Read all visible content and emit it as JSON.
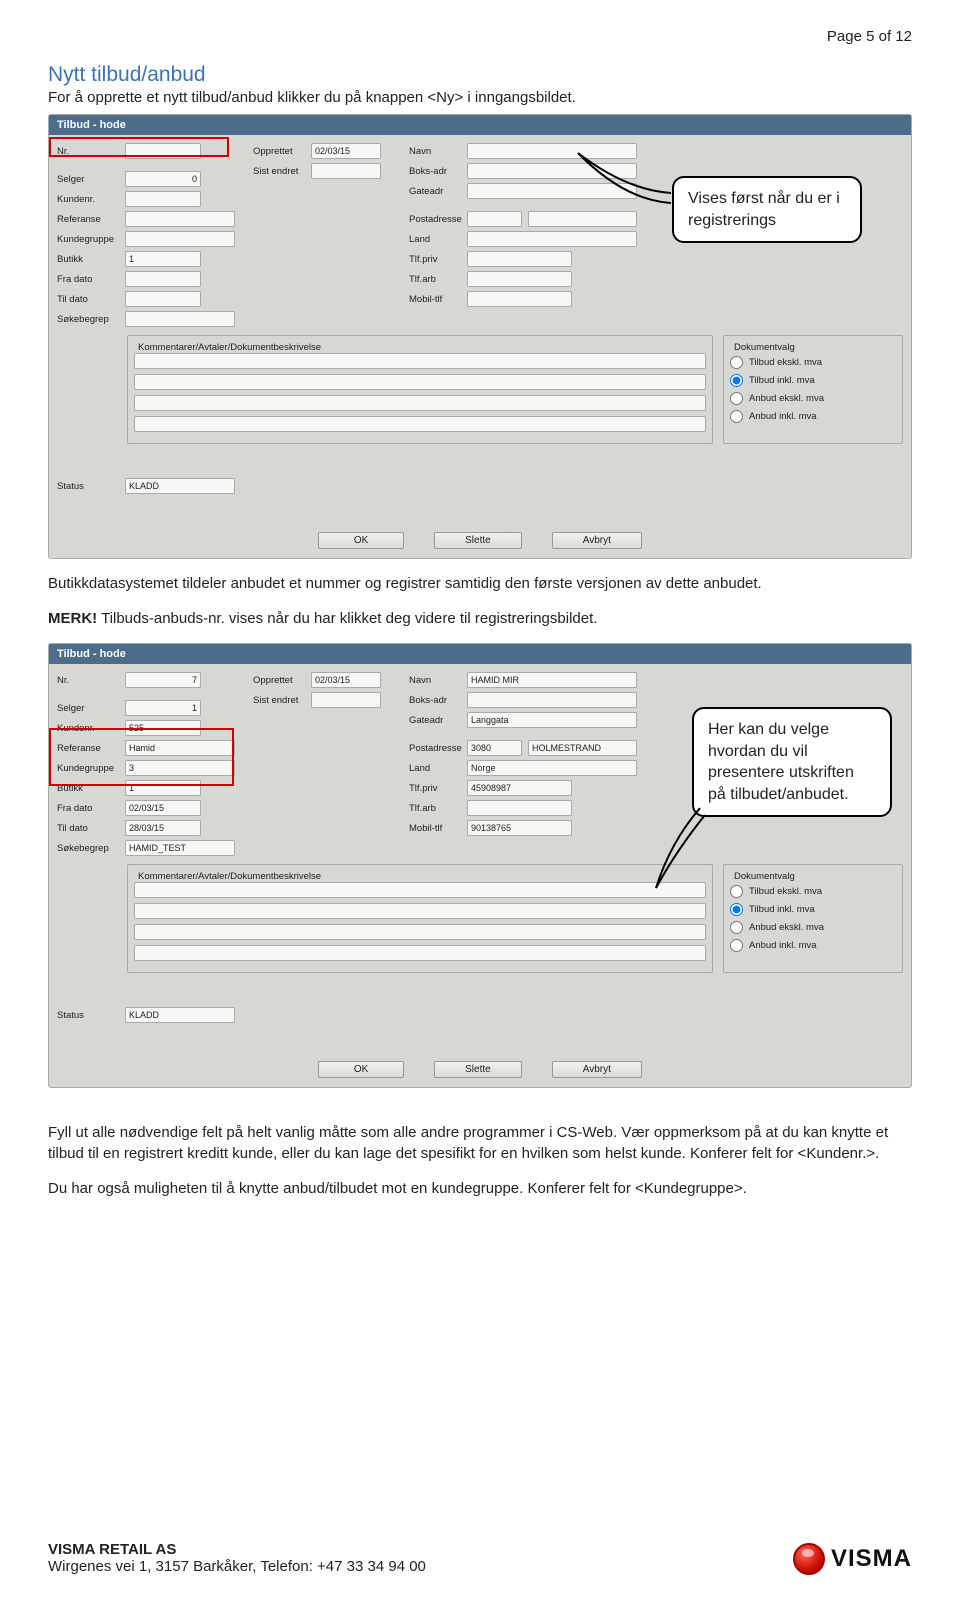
{
  "page_num": "Page 5 of 12",
  "doc": {
    "title": "Nytt tilbud/anbud",
    "intro": "For å opprette et nytt tilbud/anbud klikker du på knappen <Ny> i inngangsbildet."
  },
  "panel1": {
    "header": "Tilbud - hode",
    "left": {
      "nr": {
        "label": "Nr.",
        "value": ""
      },
      "selger": {
        "label": "Selger",
        "value": "0"
      },
      "kundenr": {
        "label": "Kundenr.",
        "value": ""
      },
      "referanse": {
        "label": "Referanse",
        "value": ""
      },
      "kundegruppe": {
        "label": "Kundegruppe",
        "value": ""
      },
      "butikk": {
        "label": "Butikk",
        "value": "1"
      },
      "fradato": {
        "label": "Fra dato",
        "value": ""
      },
      "tildato": {
        "label": "Til dato",
        "value": ""
      },
      "sokebegrep": {
        "label": "Søkebegrep",
        "value": ""
      }
    },
    "mid": {
      "opprettet": {
        "label": "Opprettet",
        "value": "02/03/15"
      },
      "sistendret": {
        "label": "Sist endret",
        "value": ""
      }
    },
    "right": {
      "navn": {
        "label": "Navn",
        "value": ""
      },
      "boksadr": {
        "label": "Boks-adr",
        "value": ""
      },
      "gateadr": {
        "label": "Gateadr",
        "value": ""
      },
      "postadr": {
        "label": "Postadresse",
        "value1": "",
        "value2": ""
      },
      "land": {
        "label": "Land",
        "value": ""
      },
      "tlfpriv": {
        "label": "Tlf.priv",
        "value": ""
      },
      "tlfarb": {
        "label": "Tlf.arb",
        "value": ""
      },
      "mobil": {
        "label": "Mobil-tlf",
        "value": ""
      }
    },
    "komment_title": "Kommentarer/Avtaler/Dokumentbeskrivelse",
    "dokvalg_title": "Dokumentvalg",
    "dokvalg": [
      {
        "label": "Tilbud ekskl. mva",
        "checked": false
      },
      {
        "label": "Tilbud inkl. mva",
        "checked": true
      },
      {
        "label": "Anbud ekskl. mva",
        "checked": false
      },
      {
        "label": "Anbud inkl. mva",
        "checked": false
      }
    ],
    "status": {
      "label": "Status",
      "value": "KLADD"
    },
    "buttons": {
      "ok": "OK",
      "slette": "Slette",
      "avbryt": "Avbryt"
    }
  },
  "callout1": "Vises først når du er i registrerings",
  "para1": "Butikkdatasystemet tildeler anbudet et nummer og registrer samtidig den første versjonen av dette anbudet.",
  "para2a": "MERK!",
  "para2b": " Tilbuds-anbuds-nr. vises når du har klikket deg videre til registreringsbildet.",
  "panel2": {
    "header": "Tilbud - hode",
    "left": {
      "nr": {
        "label": "Nr.",
        "value": "7"
      },
      "selger": {
        "label": "Selger",
        "value": "1"
      },
      "kundenr": {
        "label": "Kundenr.",
        "value": "525"
      },
      "referanse": {
        "label": "Referanse",
        "value": "Hamid"
      },
      "kundegruppe": {
        "label": "Kundegruppe",
        "value": "3"
      },
      "butikk": {
        "label": "Butikk",
        "value": "1"
      },
      "fradato": {
        "label": "Fra dato",
        "value": "02/03/15"
      },
      "tildato": {
        "label": "Til dato",
        "value": "28/03/15"
      },
      "sokebegrep": {
        "label": "Søkebegrep",
        "value": "HAMID_TEST"
      }
    },
    "mid": {
      "opprettet": {
        "label": "Opprettet",
        "value": "02/03/15"
      },
      "sistendret": {
        "label": "Sist endret",
        "value": ""
      }
    },
    "right": {
      "navn": {
        "label": "Navn",
        "value": "HAMID MIR"
      },
      "boksadr": {
        "label": "Boks-adr",
        "value": ""
      },
      "gateadr": {
        "label": "Gateadr",
        "value": "Langgata"
      },
      "postadr": {
        "label": "Postadresse",
        "value1": "3080",
        "value2": "HOLMESTRAND"
      },
      "land": {
        "label": "Land",
        "value": "Norge"
      },
      "tlfpriv": {
        "label": "Tlf.priv",
        "value": "45908987"
      },
      "tlfarb": {
        "label": "Tlf.arb",
        "value": ""
      },
      "mobil": {
        "label": "Mobil-tlf",
        "value": "90138765"
      }
    },
    "komment_title": "Kommentarer/Avtaler/Dokumentbeskrivelse",
    "dokvalg_title": "Dokumentvalg",
    "dokvalg": [
      {
        "label": "Tilbud ekskl. mva",
        "checked": false
      },
      {
        "label": "Tilbud inkl. mva",
        "checked": true
      },
      {
        "label": "Anbud ekskl. mva",
        "checked": false
      },
      {
        "label": "Anbud inkl. mva",
        "checked": false
      }
    ],
    "status": {
      "label": "Status",
      "value": "KLADD"
    },
    "buttons": {
      "ok": "OK",
      "slette": "Slette",
      "avbryt": "Avbryt"
    }
  },
  "callout2": "Her kan du velge hvordan du vil presentere utskriften på tilbudet/anbudet.",
  "para3": "Fyll ut alle nødvendige felt på helt vanlig måtte som alle andre programmer i CS-Web. Vær oppmerksom på at du kan knytte et tilbud til en registrert kreditt kunde, eller du kan lage det spesifikt for en hvilken som helst kunde. Konferer felt for <Kundenr.>.",
  "para4": "Du har også muligheten til å knytte anbud/tilbudet mot en kundegruppe. Konferer felt for <Kundegruppe>.",
  "footer": {
    "company": "VISMA RETAIL AS",
    "address": "Wirgenes vei 1, 3157 Barkåker, Telefon: +47 33 34 94 00",
    "logo_text": "VISMA"
  }
}
